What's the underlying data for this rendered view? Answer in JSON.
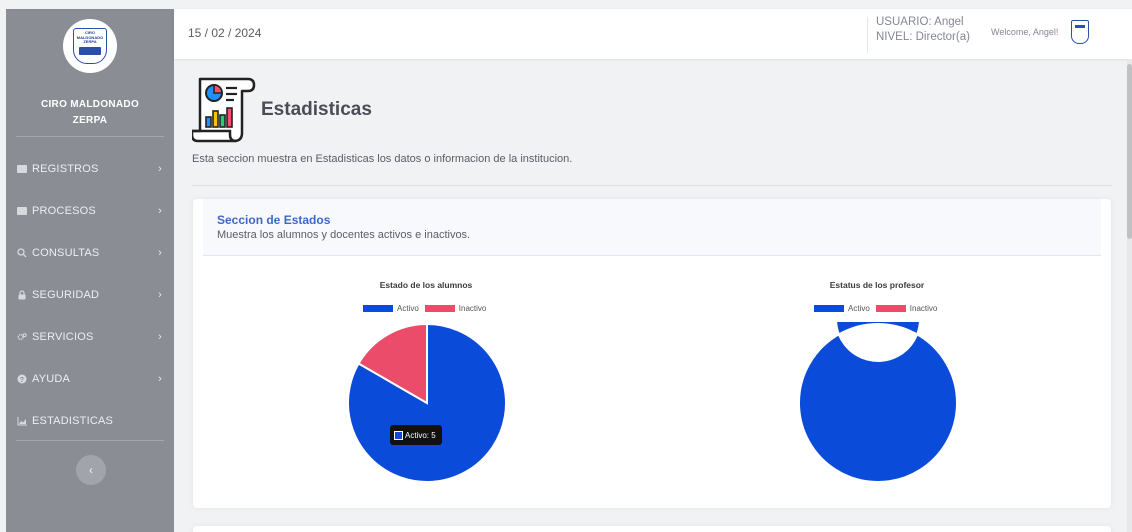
{
  "sidebar": {
    "logo_text": "CIRO MALDONADO ZERPA",
    "brand_line1": "CIRO MALDONADO",
    "brand_line2": "ZERPA",
    "items": [
      {
        "label": "REGISTROS",
        "icon": "folder-icon"
      },
      {
        "label": "PROCESOS",
        "icon": "folder-icon"
      },
      {
        "label": "CONSULTAS",
        "icon": "search-icon"
      },
      {
        "label": "SEGURIDAD",
        "icon": "lock-icon"
      },
      {
        "label": "SERVICIOS",
        "icon": "cogs-icon"
      },
      {
        "label": "AYUDA",
        "icon": "question-icon"
      },
      {
        "label": "ESTADISTICAS",
        "icon": "chart-area-icon"
      }
    ],
    "chevron": "›",
    "toggle": "‹"
  },
  "topbar": {
    "date": "15 / 02 / 2024",
    "user": "USUARIO: Angel",
    "level": "NIVEL: Director(a)",
    "welcome": "Welcome, Angel!"
  },
  "page": {
    "title": "Estadisticas",
    "description": "Esta seccion muestra en Estadisticas los datos o informacion de la institucion."
  },
  "card": {
    "title": "Seccion de Estados",
    "subtitle": "Muestra los alumnos y docentes activos e inactivos."
  },
  "colors": {
    "activo": "#0a4bd9",
    "inactivo": "#ea4c69"
  },
  "chart_data": [
    {
      "type": "pie",
      "title": "Estado de los alumnos",
      "categories": [
        "Activo",
        "Inactivo"
      ],
      "values": [
        5,
        1
      ],
      "legend": "top"
    },
    {
      "type": "pie",
      "title": "Estatus de los profesor",
      "categories": [
        "Activo",
        "Inactivo"
      ],
      "values": [
        1,
        0
      ],
      "legend": "top"
    }
  ],
  "tooltip": {
    "text": "Activo: 5"
  }
}
